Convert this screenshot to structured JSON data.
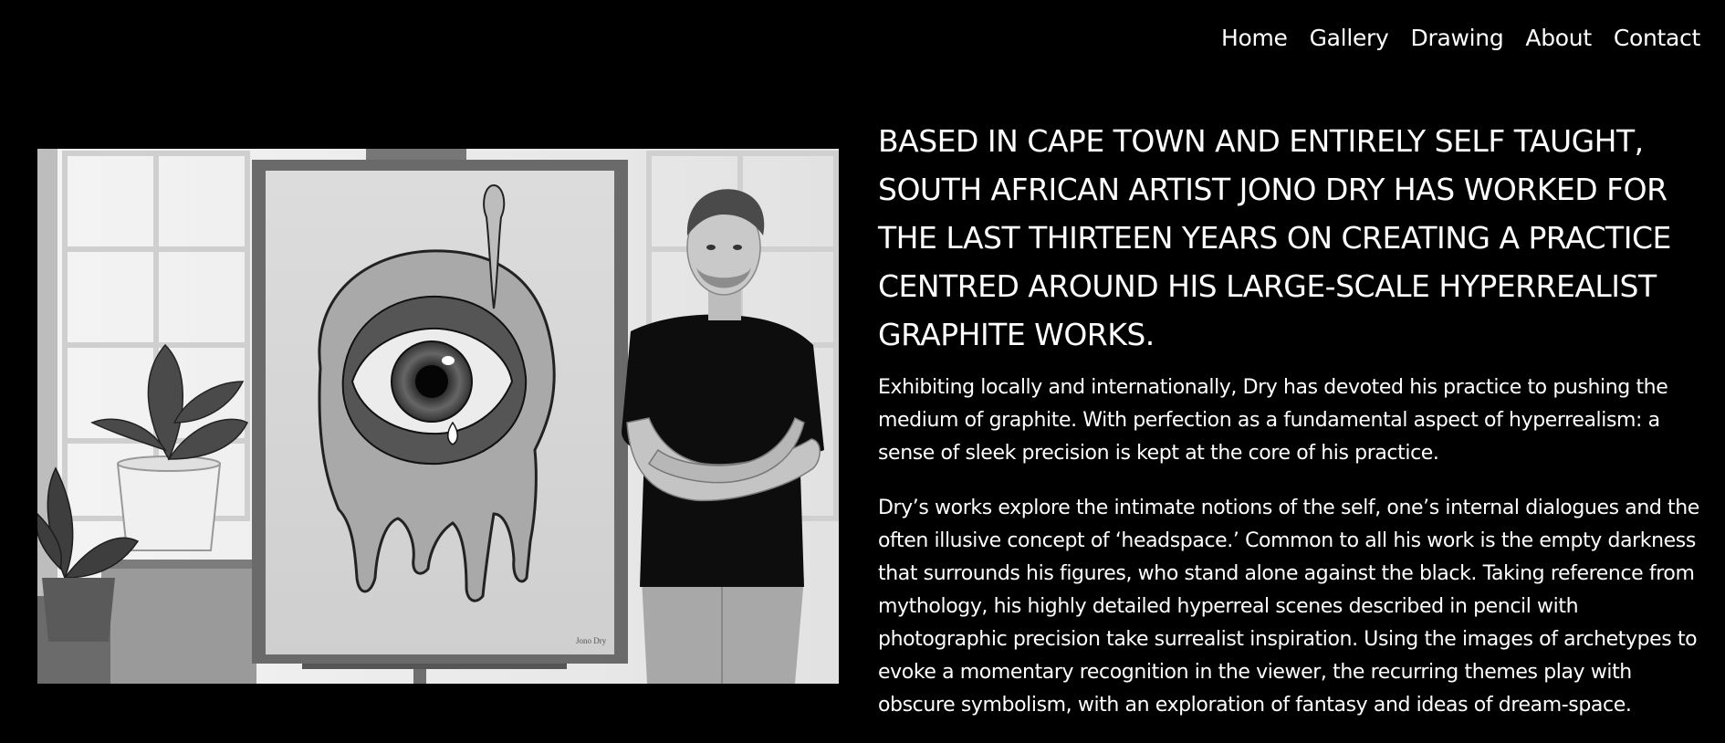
{
  "nav": {
    "items": [
      {
        "label": "Home"
      },
      {
        "label": "Gallery"
      },
      {
        "label": "Drawing"
      },
      {
        "label": "About"
      },
      {
        "label": "Contact"
      }
    ]
  },
  "photo": {
    "icon": "artist-portrait-photo",
    "signature": "Jono Dry"
  },
  "about": {
    "headline": "BASED IN CAPE TOWN AND ENTIRELY SELF TAUGHT, SOUTH AFRICAN ARTIST JONO DRY HAS WORKED FOR THE LAST THIRTEEN YEARS ON CREATING A PRACTICE CENTRED AROUND HIS LARGE-SCALE HYPERREALIST GRAPHITE WORKS.",
    "paragraph1": "Exhibiting locally and internationally, Dry has devoted his practice to pushing the medium of graphite. With perfection as a fundamental aspect of hyperrealism: a sense of sleek precision is kept at the core of his practice.",
    "paragraph2": "Dry’s works explore the intimate notions of the self, one’s internal dialogues and the often illusive concept of ‘headspace.’ Common to all his work is the empty darkness that surrounds his figures, who stand alone against the black. Taking reference from mythology, his highly detailed hyperreal scenes described in pencil with photographic precision take surrealist inspiration. Using the images of archetypes to evoke a momentary recognition in the viewer, the recurring themes play with obscure symbolism, with an exploration of fantasy and ideas of dream-space."
  }
}
